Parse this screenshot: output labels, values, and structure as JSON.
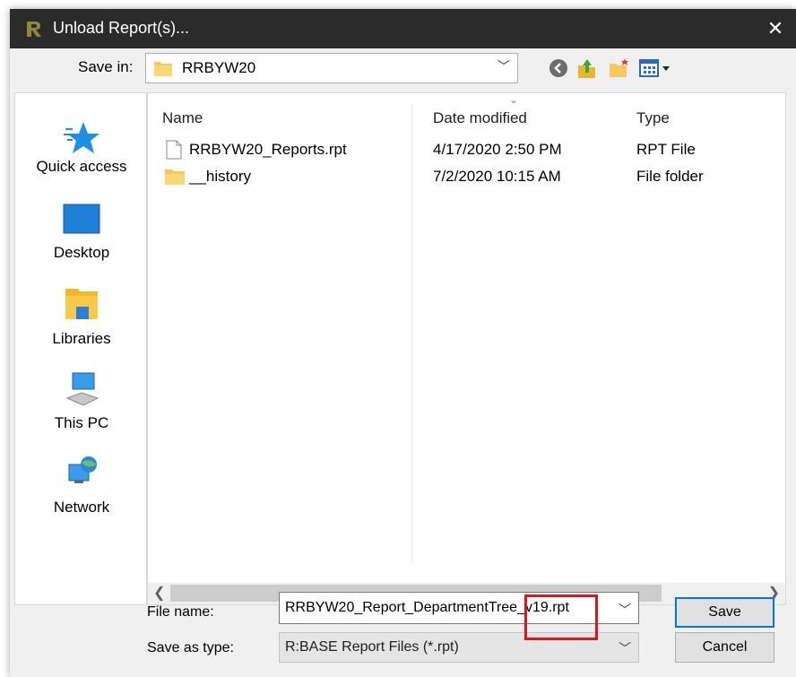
{
  "window": {
    "title": "Unload Report(s)...",
    "close_glyph": "✕"
  },
  "save_in": {
    "label": "Save in:",
    "value": "RRBYW20"
  },
  "places": [
    {
      "label": "Quick access",
      "icon": "star-icon"
    },
    {
      "label": "Desktop",
      "icon": "desktop-icon"
    },
    {
      "label": "Libraries",
      "icon": "libraries-icon"
    },
    {
      "label": "This PC",
      "icon": "computer-icon"
    },
    {
      "label": "Network",
      "icon": "network-icon"
    }
  ],
  "columns": {
    "name": "Name",
    "date": "Date modified",
    "type": "Type"
  },
  "files": [
    {
      "name": "RRBYW20_Reports.rpt",
      "date": "4/17/2020 2:50 PM",
      "type": "RPT File",
      "icon": "file-icon"
    },
    {
      "name": "__history",
      "date": "7/2/2020 10:15 AM",
      "type": "File folder",
      "icon": "folder-icon"
    }
  ],
  "file_name": {
    "label": "File name:",
    "value": "RRBYW20_Report_DepartmentTree_v19.rpt"
  },
  "save_as_type": {
    "label": "Save as type:",
    "value": "R:BASE Report Files (*.rpt)"
  },
  "buttons": {
    "save": "Save",
    "cancel": "Cancel"
  },
  "colors": {
    "titlebar": "#2b2b2b",
    "accent": "#0078d7",
    "highlight": "#e0141e"
  }
}
